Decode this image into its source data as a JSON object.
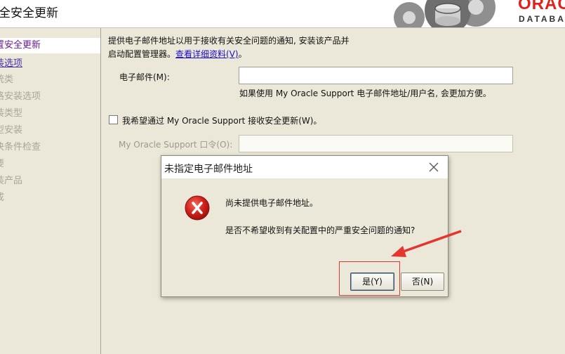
{
  "header": {
    "title": "全安全更新",
    "logo_text": "ORACLE",
    "logo_sub": "DATABASE"
  },
  "sidebar": {
    "items": [
      {
        "label": "置安全更新",
        "state": "current"
      },
      {
        "label": "装选项",
        "state": "link"
      },
      {
        "label": "统类",
        "state": "disabled"
      },
      {
        "label": "格安装选项",
        "state": "disabled"
      },
      {
        "label": "装类型",
        "state": "disabled"
      },
      {
        "label": "型安装",
        "state": "disabled"
      },
      {
        "label": "决条件检查",
        "state": "disabled"
      },
      {
        "label": "要",
        "state": "disabled"
      },
      {
        "label": "装产品",
        "state": "disabled"
      },
      {
        "label": "成",
        "state": "disabled"
      }
    ]
  },
  "content": {
    "description_line1": "提供电子邮件地址以用于接收有关安全问题的通知, 安装该产品并",
    "description_line2": "启动配置管理器。",
    "details_link": "查看详细资料(V)",
    "description_end": "。",
    "email_label": "电子邮件(M):",
    "email_value": "",
    "email_hint": "如果使用 My Oracle Support 电子邮件地址/用户名, 会更加方便。",
    "checkbox_label": "我希望通过 My Oracle Support 接收安全更新(W)。",
    "checkbox_checked": false,
    "password_label": "My Oracle Support 口令(O):",
    "password_value": ""
  },
  "dialog": {
    "title": "未指定电子邮件地址",
    "message1": "尚未提供电子邮件地址。",
    "message2": "是否不希望收到有关配置中的严重安全问题的通知?",
    "yes_label": "是(Y)",
    "no_label": "否(N)",
    "icon": "error-icon"
  },
  "colors": {
    "accent_red": "#e4352f",
    "link": "#1a0dcc",
    "current_step": "#6a1b9a",
    "background": "#ebe8d9"
  }
}
